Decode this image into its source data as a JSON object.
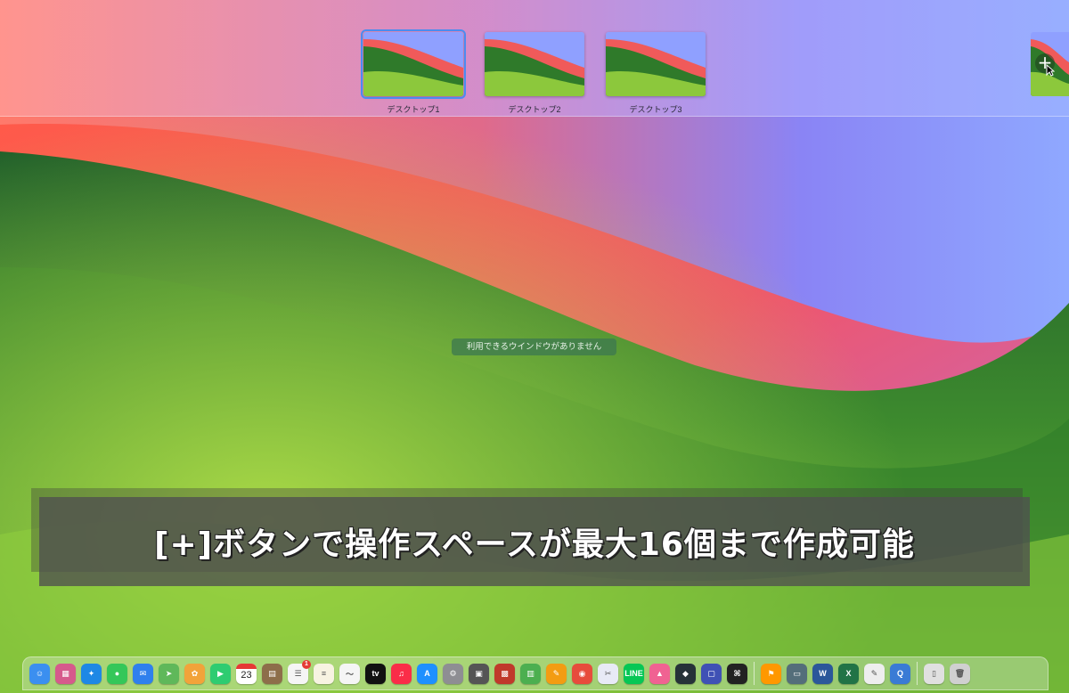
{
  "mission_control": {
    "spaces": [
      {
        "label": "デスクトップ1",
        "selected": true
      },
      {
        "label": "デスクトップ2",
        "selected": false
      },
      {
        "label": "デスクトップ3",
        "selected": false
      }
    ],
    "add_space_symbol": "+",
    "no_windows_message": "利用できるウインドウがありません"
  },
  "caption": {
    "text": "[+]ボタンで操作スペースが最大16個まで作成可能"
  },
  "dock": {
    "apps": [
      {
        "name": "finder-icon",
        "color": "#3b8ff0",
        "glyph": "☺"
      },
      {
        "name": "launchpad-icon",
        "color": "#d65a8c",
        "glyph": "▦"
      },
      {
        "name": "safari-icon",
        "color": "#1e88e5",
        "glyph": "✦"
      },
      {
        "name": "messages-icon",
        "color": "#34c759",
        "glyph": "●"
      },
      {
        "name": "mail-icon",
        "color": "#2f80ed",
        "glyph": "✉"
      },
      {
        "name": "maps-icon",
        "color": "#5fb85a",
        "glyph": "➤"
      },
      {
        "name": "photos-icon",
        "color": "#f2a33a",
        "glyph": "✿"
      },
      {
        "name": "facetime-icon",
        "color": "#2ecc71",
        "glyph": "▶"
      },
      {
        "name": "calendar-icon",
        "color": "#ffffff",
        "glyph": ""
      },
      {
        "name": "notes-app-icon",
        "color": "#8d6e4a",
        "glyph": "▤"
      },
      {
        "name": "reminders-icon",
        "color": "#f5f5f5",
        "glyph": "☰",
        "badge": "1"
      },
      {
        "name": "notes-icon",
        "color": "#f7f3e1",
        "glyph": "≡"
      },
      {
        "name": "freeform-icon",
        "color": "#f5f5f5",
        "glyph": "〜"
      },
      {
        "name": "apple-tv-icon",
        "color": "#111111",
        "glyph": "tv"
      },
      {
        "name": "music-icon",
        "color": "#fa2d48",
        "glyph": "♫"
      },
      {
        "name": "app-store-icon",
        "color": "#1e90ff",
        "glyph": "A"
      },
      {
        "name": "system-settings-icon",
        "color": "#8e8e93",
        "glyph": "⚙"
      },
      {
        "name": "image-capture-icon",
        "color": "#555555",
        "glyph": "▣"
      },
      {
        "name": "photo-booth-icon",
        "color": "#c0392b",
        "glyph": "▩"
      },
      {
        "name": "numbers-icon",
        "color": "#4caf50",
        "glyph": "▥"
      },
      {
        "name": "pages-icon",
        "color": "#f39c12",
        "glyph": "✎"
      },
      {
        "name": "chrome-icon",
        "color": "#e74c3c",
        "glyph": "◉"
      },
      {
        "name": "migration-icon",
        "color": "#e8eaf6",
        "glyph": "✂"
      },
      {
        "name": "line-icon",
        "color": "#06c755",
        "glyph": "LINE"
      },
      {
        "name": "affinity-icon",
        "color": "#f06292",
        "glyph": "▲"
      },
      {
        "name": "capcut-icon",
        "color": "#263238",
        "glyph": "◆"
      },
      {
        "name": "screenshot-icon",
        "color": "#3f51b5",
        "glyph": "▢"
      },
      {
        "name": "terminal-icon",
        "color": "#222222",
        "glyph": "⌘"
      }
    ],
    "apps_right": [
      {
        "name": "installer-icon",
        "color": "#ff9800",
        "glyph": "⚑"
      },
      {
        "name": "preview-icon",
        "color": "#546e7a",
        "glyph": "▭"
      },
      {
        "name": "word-icon",
        "color": "#2b579a",
        "glyph": "W"
      },
      {
        "name": "excel-icon",
        "color": "#217346",
        "glyph": "X"
      },
      {
        "name": "textedit-icon",
        "color": "#eeeeee",
        "glyph": "✎"
      },
      {
        "name": "quicktime-icon",
        "color": "#3a7bd5",
        "glyph": "Q"
      }
    ],
    "apps_end": [
      {
        "name": "downloads-folder-icon",
        "color": "#e0e0e0",
        "glyph": "▯"
      },
      {
        "name": "trash-icon",
        "color": "#d0d0d0",
        "glyph": "🗑"
      }
    ],
    "calendar": {
      "month": "",
      "day": "23"
    }
  }
}
